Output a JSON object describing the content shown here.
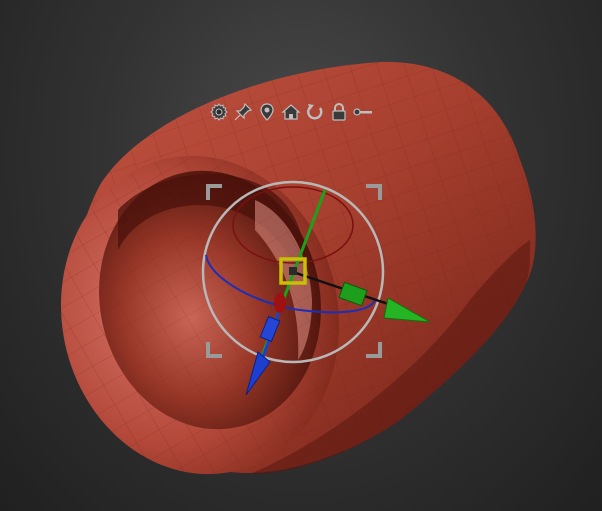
{
  "app": {
    "view": "3D viewport"
  },
  "toolbar": {
    "icons": [
      "gear-icon",
      "pin-icon",
      "location-pin-icon",
      "home-icon",
      "reset-rotation-icon",
      "lock-icon",
      "key-icon"
    ]
  },
  "colors": {
    "background": "#2b2b2b",
    "mesh": "#a33a2c",
    "mesh_highlight": "#cf6a5a",
    "mesh_shadow": "#5e1a12",
    "gizmo_x": "#1aa31a",
    "gizmo_y": "#1c5fd6",
    "gizmo_z": "#0f5c0f",
    "gizmo_ring": "#b8b8b8",
    "gizmo_center": "#c8c000"
  }
}
